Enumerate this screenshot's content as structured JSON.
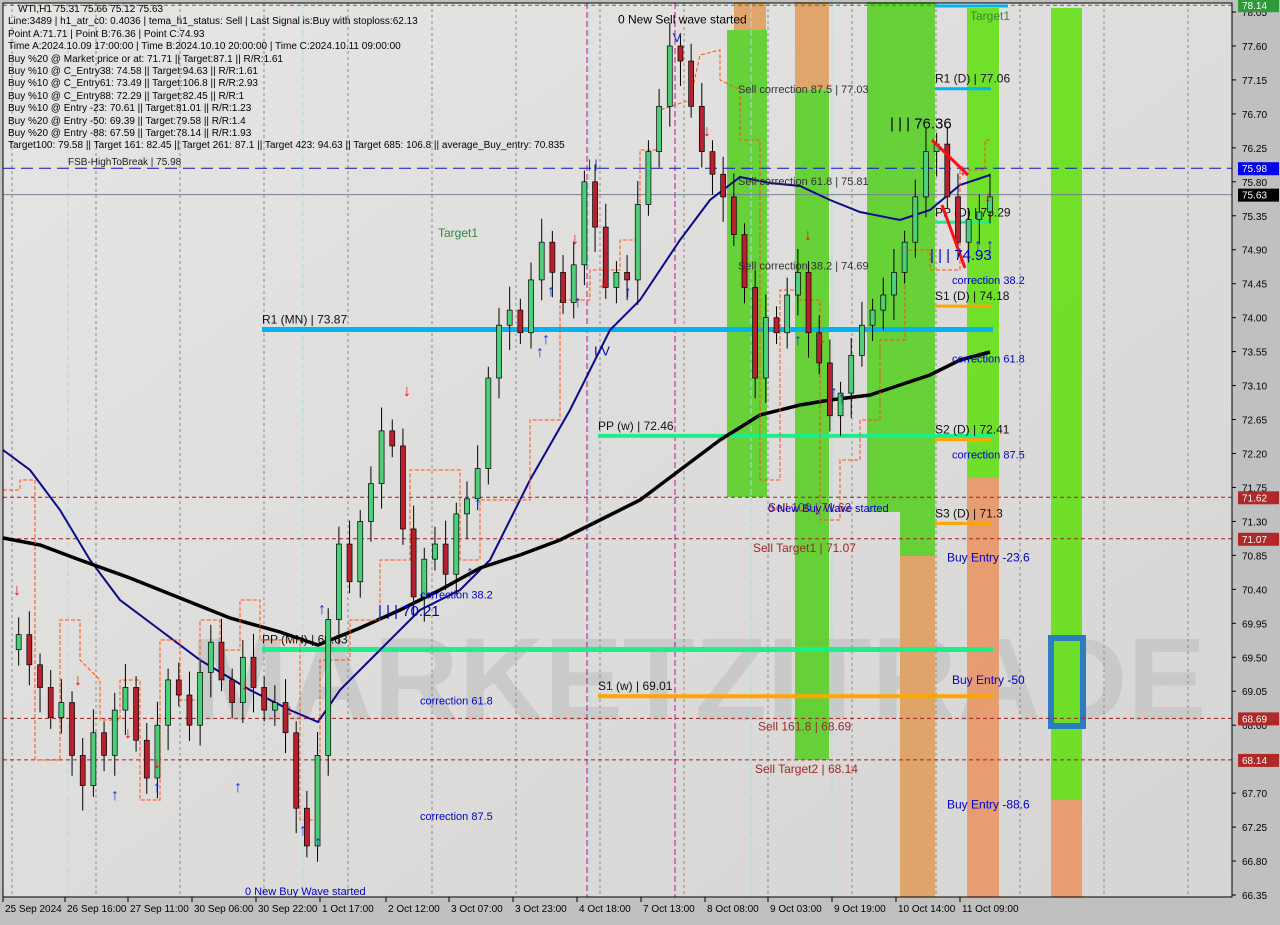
{
  "window": {
    "symbol_header": "WTI,H1  75.31 75.66 75.12 75.63"
  },
  "info_lines": [
    "Line:3489 | h1_atr_c0: 0.4036 | tema_h1_status: Sell | Last Signal is:Buy with stoploss:62.13",
    "Point A:71.71 | Point B:76.36 | Point C:74.93",
    "Time A:2024.10.09 17:00:00 | Time B:2024.10.10 20:00:00 | Time C:2024.10.11 09:00:00",
    "Buy %20 @ Market price or at: 71.71 || Target:87.1 || R/R:1.61",
    "Buy %10 @ C_Entry38: 74.58 || Target:94.63 || R/R:1.61",
    "Buy %10 @ C_Entry61: 73.49 || Target:106.8 || R/R:2.93",
    "Buy %10 @ C_Entry88: 72.29 || Target:82.45 || R/R:1",
    "Buy %10 @ Entry -23: 70.61 || Target:81.01 || R/R:1.23",
    "Buy %20 @ Entry -50: 69.39 || Target:79.58 || R/R:1.4",
    "Buy %20 @ Entry -88: 67.59 || Target:78.14 || R/R:1.93",
    "Target100: 79.58 || Target 161: 82.45 || Target 261: 87.1 || Target 423: 94.63 || Target 685: 106.8 || average_Buy_entry: 70.835"
  ],
  "colors": {
    "background": "#dcdcdc",
    "axis_bg": "#c0c0c0",
    "bull_candle": "#4ccf7a",
    "bear_candle": "#b8202e",
    "green_zone": "#5ccf2a",
    "bright_green_zone": "#66e01a",
    "orange_zone": "#e0a060",
    "salmon_zone": "#e89868",
    "pivot_blue": "#00b4f0",
    "pivot_green": "#19f08a",
    "pivot_orange": "#ffa500",
    "ma_navy": "#0a0a8c",
    "ma_black": "#000000",
    "sell_level": "#a02020",
    "blue_text": "#0000cc",
    "stop_line": "#ff5010"
  },
  "chart_data": {
    "type": "candlestick",
    "symbol": "WTI",
    "timeframe": "H1",
    "ohlc_current": {
      "open": 75.31,
      "high": 75.66,
      "low": 75.12,
      "close": 75.63
    },
    "ylim": [
      66.35,
      78.14
    ],
    "y_ticks": [
      "78.05",
      "77.60",
      "77.15",
      "76.70",
      "76.25",
      "75.80",
      "75.35",
      "74.90",
      "74.45",
      "74.00",
      "73.55",
      "73.10",
      "72.65",
      "72.20",
      "71.75",
      "71.30",
      "70.85",
      "70.40",
      "69.95",
      "69.50",
      "69.05",
      "68.60",
      "67.70",
      "67.25",
      "66.80",
      "66.35"
    ],
    "x_ticks": [
      "25 Sep 2024",
      "26 Sep 16:00",
      "27 Sep 11:00",
      "30 Sep 06:00",
      "30 Sep 22:00",
      "1 Oct 17:00",
      "2 Oct 12:00",
      "3 Oct 07:00",
      "3 Oct 23:00",
      "4 Oct 18:00",
      "7 Oct 13:00",
      "8 Oct 08:00",
      "9 Oct 03:00",
      "9 Oct 19:00",
      "10 Oct 14:00",
      "11 Oct 09:00"
    ],
    "price_labels": [
      {
        "value": "78.14",
        "color": "#2e9a3a"
      },
      {
        "value": "75.98",
        "color": "#0000ee"
      },
      {
        "value": "75.63",
        "color": "#000000"
      },
      {
        "value": "71.62",
        "color": "#b02828"
      },
      {
        "value": "71.07",
        "color": "#b02828"
      },
      {
        "value": "68.69",
        "color": "#b02828"
      },
      {
        "value": "68.14",
        "color": "#b02828"
      }
    ],
    "horizontal_levels": [
      {
        "name": "fsb-high-to-break",
        "label": "FSB-HighToBreak | 75.98",
        "price": 75.98,
        "style": "dashed-blue"
      },
      {
        "name": "current-price",
        "label": "",
        "price": 75.63,
        "style": "solid-gray"
      },
      {
        "name": "target-green",
        "label": "",
        "price": 78.14,
        "style": "dashed-green"
      },
      {
        "name": "sell-100",
        "label": "Sell 100 | 71.62",
        "price": 71.62,
        "style": "dashed-red"
      },
      {
        "name": "sell-target1",
        "label": "Sell Target1 | 71.07",
        "price": 71.07,
        "style": "dashed-red"
      },
      {
        "name": "sell-161",
        "label": "Sell 161.8 | 68.69",
        "price": 68.69,
        "style": "dashed-red"
      },
      {
        "name": "sell-target2",
        "label": "Sell Target2 | 68.14",
        "price": 68.14,
        "style": "dashed-red"
      }
    ],
    "pivot_levels": [
      {
        "name": "r1-mn",
        "label": "R1 (MN) | 73.87",
        "price": 73.87,
        "color": "#00b4f0"
      },
      {
        "name": "pp-mn",
        "label": "PP (MN) | 69.63",
        "price": 69.63,
        "color": "#19f08a"
      },
      {
        "name": "pp-w",
        "label": "PP (w) | 72.46",
        "price": 72.46,
        "color": "#19f08a"
      },
      {
        "name": "s1-w",
        "label": "S1 (w) | 69.01",
        "price": 69.01,
        "color": "#ffa500"
      },
      {
        "name": "r1-d",
        "label": "R1 (D) | 77.06",
        "price": 77.06,
        "color": "#00b4f0"
      },
      {
        "name": "pp-d",
        "label": "PP (D) | 75.29",
        "price": 75.29,
        "color": "#19f08a"
      },
      {
        "name": "s1-d",
        "label": "S1 (D) | 74.18",
        "price": 74.18,
        "color": "#ffa500"
      },
      {
        "name": "s2-d",
        "label": "S2 (D) | 72.41",
        "price": 72.41,
        "color": "#ffa500"
      },
      {
        "name": "s3-d",
        "label": "S3 (D) | 71.3",
        "price": 71.3,
        "color": "#ffa500"
      }
    ],
    "annotations": [
      {
        "name": "new-sell-wave",
        "text": "0 New Sell wave started",
        "price": 77.95,
        "color": "#000000"
      },
      {
        "name": "new-buy-wave-top",
        "text": "0 New Buy Wave started",
        "price": 71.48,
        "color": "#0000cc"
      },
      {
        "name": "new-buy-wave-bottom",
        "text": "0 New Buy Wave started",
        "price": 66.4,
        "color": "#0000cc"
      },
      {
        "name": "sell-corr-875",
        "text": "Sell correction 87.5 | 77.03",
        "price": 77.03,
        "color": "#303030"
      },
      {
        "name": "sell-corr-618",
        "text": "Sell correction 61.8 | 75.81",
        "price": 75.81,
        "color": "#303030"
      },
      {
        "name": "sell-corr-382",
        "text": "Sell correction 38.2 | 74.69",
        "price": 74.69,
        "color": "#303030"
      },
      {
        "name": "target1-left",
        "text": "Target1",
        "price": 75.12,
        "color": "#2e8a3a"
      },
      {
        "name": "target1-right",
        "text": "Target1",
        "price": 78.0,
        "color": "#2e8a3a"
      },
      {
        "name": "point-b",
        "text": "| | | 76.36",
        "price": 76.56,
        "color": "#000000"
      },
      {
        "name": "point-c",
        "text": "| | | 74.93",
        "price": 74.82,
        "color": "#0000cc"
      },
      {
        "name": "point-a",
        "text": "| | | 70.21",
        "price": 70.1,
        "color": "#0000cc"
      },
      {
        "name": "wave-iv",
        "text": "I V",
        "price": 73.55,
        "color": "#0000cc"
      },
      {
        "name": "corr-382-left",
        "text": "correction 38.2",
        "price": 70.33,
        "color": "#0000cc"
      },
      {
        "name": "corr-618-left",
        "text": "correction 61.8",
        "price": 68.93,
        "color": "#0000cc"
      },
      {
        "name": "corr-875-left",
        "text": "correction 87.5",
        "price": 67.4,
        "color": "#0000cc"
      },
      {
        "name": "corr-382-right",
        "text": "correction 38.2",
        "price": 74.5,
        "color": "#0000cc"
      },
      {
        "name": "corr-618-right",
        "text": "correction 61.8",
        "price": 73.46,
        "color": "#0000cc"
      },
      {
        "name": "corr-875-right",
        "text": "correction 87.5",
        "price": 72.19,
        "color": "#0000cc"
      },
      {
        "name": "buy-entry-236",
        "text": "Buy Entry -23.6",
        "price": 70.82,
        "color": "#0000cc"
      },
      {
        "name": "buy-entry-50",
        "text": "Buy Entry -50",
        "price": 69.2,
        "color": "#0000cc"
      },
      {
        "name": "buy-entry-886",
        "text": "Buy Entry -88.6",
        "price": 67.55,
        "color": "#0000cc"
      }
    ],
    "watermark": "MARKETZITRADE"
  }
}
